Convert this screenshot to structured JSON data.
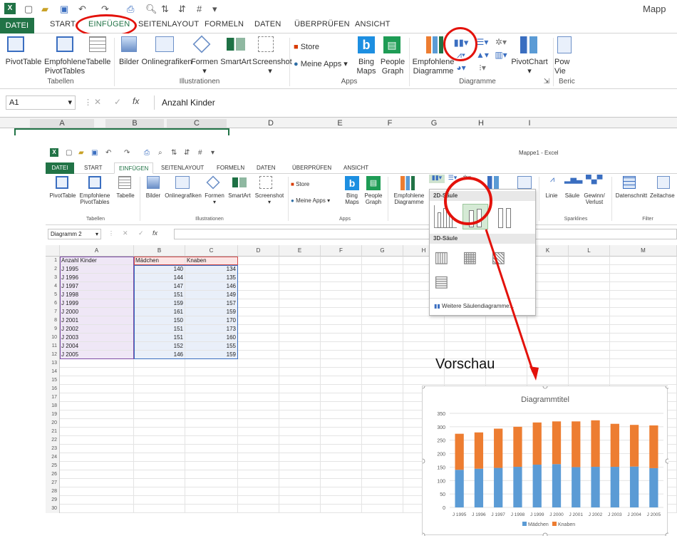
{
  "top": {
    "window_title": "Mapp",
    "tabs": [
      "DATEI",
      "START",
      "EINFÜGEN",
      "SEITENLAYOUT",
      "FORMELN",
      "DATEN",
      "ÜBERPRÜFEN",
      "ANSICHT"
    ],
    "buttons": {
      "pivottable": "PivotTable",
      "empf_pivot_1": "Empfohlene",
      "empf_pivot_2": "PivotTables",
      "tabelle": "Tabelle",
      "bilder": "Bilder",
      "onlinegrafiken": "Onlinegrafiken",
      "formen": "Formen",
      "smartart": "SmartArt",
      "screenshot": "Screenshot",
      "store": "Store",
      "meine_apps": "Meine Apps",
      "bing_1": "Bing",
      "bing_2": "Maps",
      "people_1": "People",
      "people_2": "Graph",
      "empf_diag_1": "Empfohlene",
      "empf_diag_2": "Diagramme",
      "pivotchart": "PivotChart",
      "pow_1": "Pow",
      "pow_2": "Vie"
    },
    "groups": {
      "tabellen": "Tabellen",
      "illustrationen": "Illustrationen",
      "apps": "Apps",
      "diagramme": "Diagramme",
      "berichte": "Beric"
    },
    "namebox": "A1",
    "formula": "Anzahl Kinder",
    "fx": "fx",
    "columns": [
      "A",
      "B",
      "C",
      "D",
      "E",
      "F",
      "G",
      "H",
      "I"
    ]
  },
  "bottom": {
    "window_title": "Mappe1 - Excel",
    "tabs": [
      "DATEI",
      "START",
      "EINFÜGEN",
      "SEITENLAYOUT",
      "FORMELN",
      "DATEN",
      "ÜBERPRÜFEN",
      "ANSICHT"
    ],
    "buttons": {
      "pivottable": "PivotTable",
      "empf_pivot_1": "Empfohlene",
      "empf_pivot_2": "PivotTables",
      "tabelle": "Tabelle",
      "bilder": "Bilder",
      "onlinegrafiken": "Onlinegrafiken",
      "formen": "Formen",
      "smartart": "SmartArt",
      "screenshot": "Screenshot",
      "store": "Store",
      "meine_apps": "Meine Apps",
      "bing_1": "Bing",
      "bing_2": "Maps",
      "people_1": "People",
      "people_2": "Graph",
      "empf_diag_1": "Empfohlene",
      "empf_diag_2": "Diagramme",
      "linie": "Linie",
      "saeule": "Säule",
      "gewinn_1": "Gewinn/",
      "gewinn_2": "Verlust",
      "datenschnitt": "Datenschnitt",
      "zeitachse": "Zeitachse"
    },
    "groups": {
      "tabellen": "Tabellen",
      "illustrationen": "Illustrationen",
      "apps": "Apps",
      "sparklines": "Sparklines",
      "filter": "Filter"
    },
    "namebox": "Diagramm 2",
    "fx": "fx",
    "columns": [
      "A",
      "B",
      "C",
      "D",
      "E",
      "F",
      "G",
      "H",
      "I",
      "J",
      "K",
      "L",
      "M"
    ],
    "dropdown": {
      "section_2d": "2D-Säule",
      "section_3d": "3D-Säule",
      "more": "Weitere Säulendiagramme..."
    }
  },
  "sheet": {
    "headers": [
      "Anzahl Kinder",
      "Mädchen",
      "Knaben"
    ],
    "rows": [
      [
        "J 1995",
        "140",
        "134"
      ],
      [
        "J 1996",
        "144",
        "135"
      ],
      [
        "J 1997",
        "147",
        "146"
      ],
      [
        "J 1998",
        "151",
        "149"
      ],
      [
        "J 1999",
        "159",
        "157"
      ],
      [
        "J 2000",
        "161",
        "159"
      ],
      [
        "J 2001",
        "150",
        "170"
      ],
      [
        "J 2002",
        "151",
        "173"
      ],
      [
        "J 2003",
        "151",
        "160"
      ],
      [
        "J 2004",
        "152",
        "155"
      ],
      [
        "J 2005",
        "146",
        "159"
      ]
    ],
    "row_count": 30
  },
  "annotation": {
    "vorschau": "Vorschau"
  },
  "chart_data": {
    "type": "bar",
    "stacked": true,
    "title": "Diagrammtitel",
    "categories": [
      "J 1995",
      "J 1996",
      "J 1997",
      "J 1998",
      "J 1999",
      "J 2000",
      "J 2001",
      "J 2002",
      "J 2003",
      "J 2004",
      "J 2005"
    ],
    "series": [
      {
        "name": "Mädchen",
        "values": [
          140,
          144,
          147,
          151,
          159,
          161,
          150,
          151,
          151,
          152,
          146
        ],
        "color": "#5b9bd5"
      },
      {
        "name": "Knaben",
        "values": [
          134,
          135,
          146,
          149,
          157,
          159,
          170,
          173,
          160,
          155,
          159
        ],
        "color": "#ed7d31"
      }
    ],
    "ylim": [
      0,
      350
    ],
    "yticks": [
      0,
      50,
      100,
      150,
      200,
      250,
      300,
      350
    ],
    "legend": "bottom",
    "grid": true
  },
  "colors": {
    "excel_green": "#217346",
    "highlight_red": "#e3120b"
  }
}
